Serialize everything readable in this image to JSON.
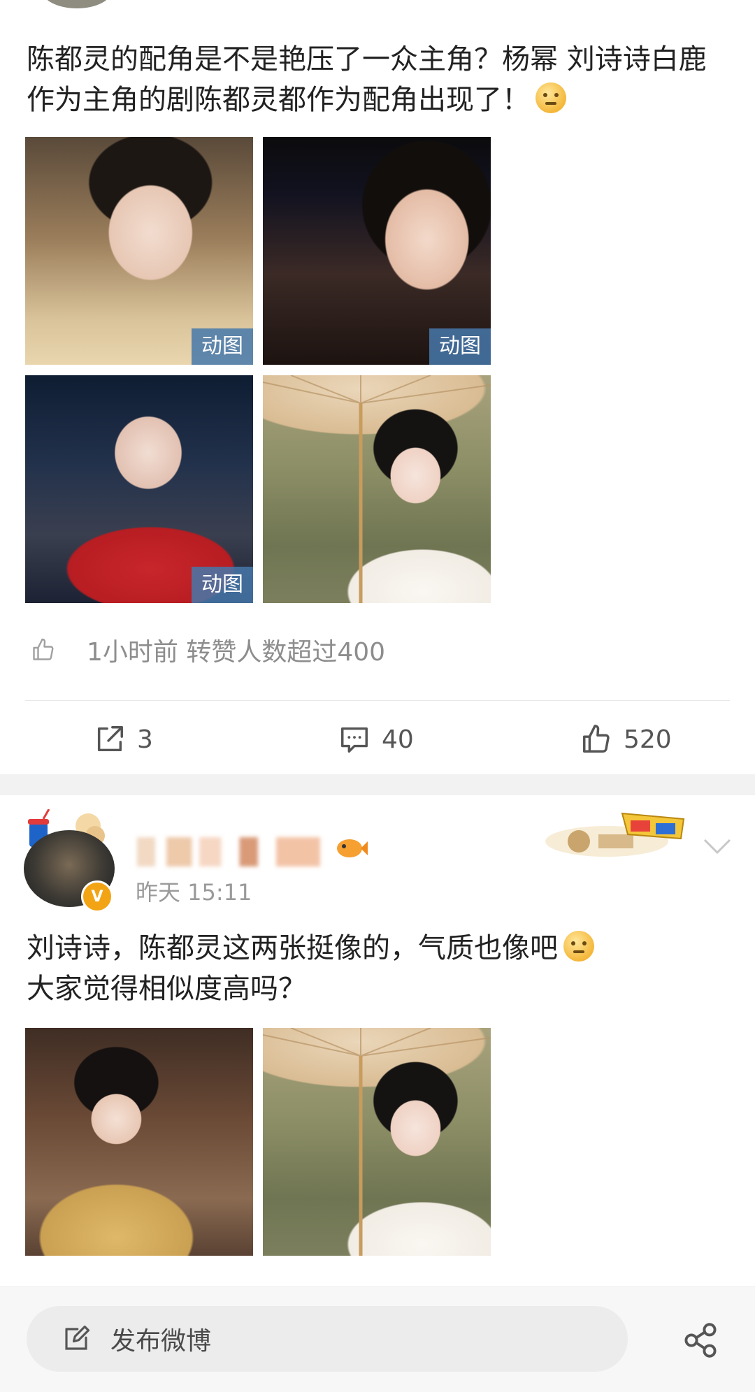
{
  "post1": {
    "text": "陈都灵的配角是不是艳压了一众主角？杨幂 刘诗诗白鹿作为主角的剧陈都灵都作为配角出现了！",
    "images": [
      {
        "badge": "动图"
      },
      {
        "badge": "动图"
      },
      {
        "badge": "动图"
      },
      {
        "badge": ""
      }
    ],
    "liked_info": "1小时前 转赞人数超过400",
    "actions": {
      "repost": "3",
      "comment": "40",
      "like": "520"
    }
  },
  "post2": {
    "time": "昨天 15:11",
    "text_line1": "刘诗诗，陈都灵这两张挺像的，气质也像吧",
    "text_line2": "大家觉得相似度高吗？",
    "avatar_badge": "V"
  },
  "bottom": {
    "compose_label": "发布微博"
  }
}
